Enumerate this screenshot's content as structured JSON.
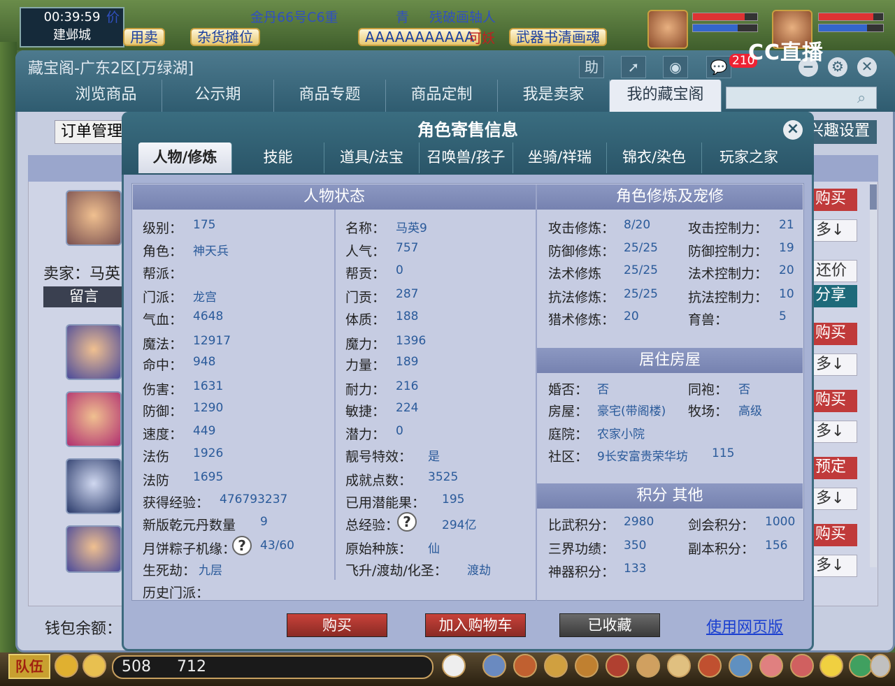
{
  "game": {
    "time": "00:39:59",
    "city": "建邺城",
    "top_buttons": [
      "用卖",
      "杂货摊位",
      "AAAAAAAAAAA",
      "武器书清画魂"
    ],
    "marquee": [
      "金丹66号C6重",
      "青",
      "残破画轴人"
    ],
    "prefix_label": "价",
    "badge_text": "可妖",
    "logo": "CC直播",
    "coords_x": "508",
    "coords_y": "712",
    "team_label": "队伍"
  },
  "window": {
    "title": "藏宝阁-广东2区[万绿湖]",
    "help": "助",
    "msg_count": "210",
    "nav_tabs": [
      "浏览商品",
      "公示期",
      "商品专题",
      "商品定制",
      "我是卖家",
      "我的藏宝阁"
    ],
    "order_mgmt": "订单管理",
    "interest": "兴趣设置",
    "seller": "卖家：马英",
    "leave_msg": "留言",
    "wallet": "钱包余额：",
    "side_buttons": [
      "购买",
      "多↓",
      "还价",
      "分享",
      "购买",
      "多↓",
      "购买",
      "多↓",
      "预定",
      "多↓",
      "购买",
      "多↓"
    ]
  },
  "modal": {
    "title": "角色寄售信息",
    "tabs": [
      "人物/修炼",
      "技能",
      "道具/法宝",
      "召唤兽/孩子",
      "坐骑/祥瑞",
      "锦衣/染色",
      "玩家之家"
    ],
    "sec_status": "人物状态",
    "sec_cultivation": "角色修炼及宠修",
    "sec_house": "居住房屋",
    "sec_points": "积分 其他",
    "status_left": [
      {
        "label": "级别：",
        "value": "175"
      },
      {
        "label": "角色：",
        "value": "神天兵"
      },
      {
        "label": "帮派：",
        "value": ""
      },
      {
        "label": "门派：",
        "value": "龙宫"
      },
      {
        "label": "气血：",
        "value": "4648"
      },
      {
        "label": "魔法：",
        "value": "12917"
      },
      {
        "label": "命中：",
        "value": "948"
      },
      {
        "label": "伤害：",
        "value": "1631"
      },
      {
        "label": "防御：",
        "value": "1290"
      },
      {
        "label": "速度：",
        "value": "449"
      },
      {
        "label": "法伤",
        "value": "1926"
      },
      {
        "label": "法防",
        "value": "1695"
      },
      {
        "label": "获得经验：",
        "value": "476793237"
      },
      {
        "label": "新版乾元丹数量",
        "value": "9"
      },
      {
        "label": "月饼粽子机缘：",
        "value": "43/60"
      },
      {
        "label": "生死劫：",
        "value": "九层"
      },
      {
        "label": "历史门派：",
        "value": ""
      }
    ],
    "status_right": [
      {
        "label": "名称：",
        "value": "马英9"
      },
      {
        "label": "人气：",
        "value": "757"
      },
      {
        "label": "帮贡：",
        "value": "0"
      },
      {
        "label": "门贡：",
        "value": "287"
      },
      {
        "label": "体质：",
        "value": "188"
      },
      {
        "label": "魔力：",
        "value": "1396"
      },
      {
        "label": "力量：",
        "value": "189"
      },
      {
        "label": "耐力：",
        "value": "216"
      },
      {
        "label": "敏捷：",
        "value": "224"
      },
      {
        "label": "潜力：",
        "value": "0"
      },
      {
        "label": "靓号特效：",
        "value": "是"
      },
      {
        "label": "成就点数：",
        "value": "3525"
      },
      {
        "label": "已用潜能果：",
        "value": "195"
      },
      {
        "label": "总经验：",
        "value": "294亿"
      },
      {
        "label": "原始种族：",
        "value": "仙"
      },
      {
        "label": "飞升/渡劫/化圣：",
        "value": "渡劫"
      }
    ],
    "cultivation": [
      {
        "label": "攻击修炼：",
        "value": "8/20",
        "label2": "攻击控制力：",
        "value2": "21"
      },
      {
        "label": "防御修炼：",
        "value": "25/25",
        "label2": "防御控制力：",
        "value2": "19"
      },
      {
        "label": "法术修炼",
        "value": "25/25",
        "label2": "法术控制力：",
        "value2": "20"
      },
      {
        "label": "抗法修炼：",
        "value": "25/25",
        "label2": "抗法控制力：",
        "value2": "10"
      },
      {
        "label": "猎术修炼：",
        "value": "20",
        "label2": "育兽：",
        "value2": "5"
      }
    ],
    "house": [
      {
        "label": "婚否：",
        "value": "否",
        "label2": "同袍：",
        "value2": "否"
      },
      {
        "label": "房屋：",
        "value": "豪宅(带阁楼)",
        "label2": "牧场：",
        "value2": "高级"
      },
      {
        "label": "庭院：",
        "value": "农家小院",
        "label2": "",
        "value2": ""
      },
      {
        "label": "社区：",
        "value": "9长安富贵荣华坊",
        "label2": "",
        "value2": "115"
      }
    ],
    "points": [
      {
        "label": "比武积分：",
        "value": "2980",
        "label2": "剑会积分：",
        "value2": "1000"
      },
      {
        "label": "三界功绩：",
        "value": "350",
        "label2": "副本积分：",
        "value2": "156"
      },
      {
        "label": "神器积分：",
        "value": "133",
        "label2": "",
        "value2": ""
      }
    ],
    "help_mark": "?",
    "btn_buy": "购买",
    "btn_cart": "加入购物车",
    "btn_fav": "已收藏",
    "web_link": "使用网页版"
  }
}
